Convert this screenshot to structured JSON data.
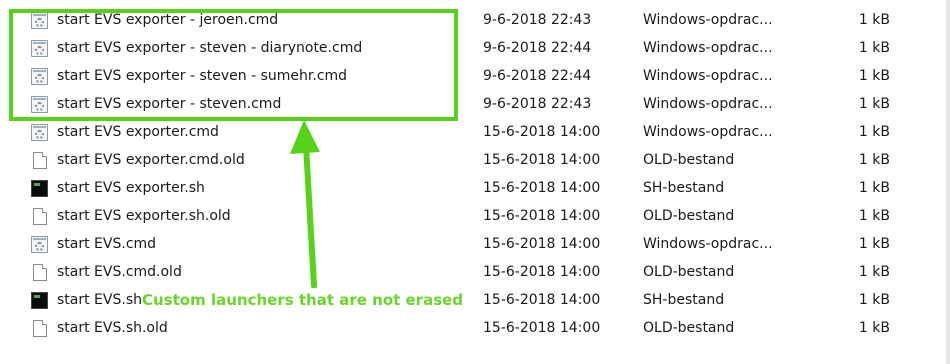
{
  "files": [
    {
      "name": "start EVS exporter - jeroen.cmd",
      "date": "9-6-2018 22:43",
      "type": "Windows-opdrac...",
      "size": "1 kB",
      "icon": "cmd-file-icon"
    },
    {
      "name": "start EVS exporter - steven - diarynote.cmd",
      "date": "9-6-2018 22:44",
      "type": "Windows-opdrac...",
      "size": "1 kB",
      "icon": "cmd-file-icon"
    },
    {
      "name": "start EVS exporter - steven - sumehr.cmd",
      "date": "9-6-2018 22:44",
      "type": "Windows-opdrac...",
      "size": "1 kB",
      "icon": "cmd-file-icon"
    },
    {
      "name": "start EVS exporter - steven.cmd",
      "date": "9-6-2018 22:43",
      "type": "Windows-opdrac...",
      "size": "1 kB",
      "icon": "cmd-file-icon"
    },
    {
      "name": "start EVS exporter.cmd",
      "date": "15-6-2018 14:00",
      "type": "Windows-opdrac...",
      "size": "1 kB",
      "icon": "cmd-file-icon"
    },
    {
      "name": "start EVS exporter.cmd.old",
      "date": "15-6-2018 14:00",
      "type": "OLD-bestand",
      "size": "1 kB",
      "icon": "document-icon"
    },
    {
      "name": "start EVS exporter.sh",
      "date": "15-6-2018 14:00",
      "type": "SH-bestand",
      "size": "1 kB",
      "icon": "terminal-icon"
    },
    {
      "name": "start EVS exporter.sh.old",
      "date": "15-6-2018 14:00",
      "type": "OLD-bestand",
      "size": "1 kB",
      "icon": "document-icon"
    },
    {
      "name": "start EVS.cmd",
      "date": "15-6-2018 14:00",
      "type": "Windows-opdrac...",
      "size": "1 kB",
      "icon": "cmd-file-icon"
    },
    {
      "name": "start EVS.cmd.old",
      "date": "15-6-2018 14:00",
      "type": "OLD-bestand",
      "size": "1 kB",
      "icon": "document-icon"
    },
    {
      "name": "start EVS.sh",
      "date": "15-6-2018 14:00",
      "type": "SH-bestand",
      "size": "1 kB",
      "icon": "terminal-icon"
    },
    {
      "name": "start EVS.sh.old",
      "date": "15-6-2018 14:00",
      "type": "OLD-bestand",
      "size": "1 kB",
      "icon": "document-icon"
    }
  ],
  "annotation": {
    "text": "Custom launchers that are not erased",
    "color": "#6ad52a"
  },
  "highlight": {
    "color": "#56d21a"
  }
}
